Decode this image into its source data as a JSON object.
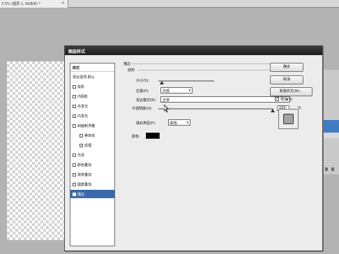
{
  "document_tab": {
    "title": "3.3% (图层 1, RGB/8) *",
    "close_glyph": "×"
  },
  "dialog": {
    "title": "图层样式",
    "styles_list": {
      "header": "样式",
      "items": [
        {
          "label": "混合选项:默认",
          "checkbox": false
        },
        {
          "label": "投影",
          "checkbox": true,
          "checked": false
        },
        {
          "label": "内阴影",
          "checkbox": true,
          "checked": false
        },
        {
          "label": "外发光",
          "checkbox": true,
          "checked": false
        },
        {
          "label": "内发光",
          "checkbox": true,
          "checked": false
        },
        {
          "label": "斜面和浮雕",
          "checkbox": true,
          "checked": false
        },
        {
          "label": "等高线",
          "checkbox": true,
          "checked": false,
          "indent": true
        },
        {
          "label": "纹理",
          "checkbox": true,
          "checked": false,
          "indent": true
        },
        {
          "label": "光泽",
          "checkbox": true,
          "checked": false
        },
        {
          "label": "颜色叠加",
          "checkbox": true,
          "checked": false
        },
        {
          "label": "渐变叠加",
          "checkbox": true,
          "checked": false
        },
        {
          "label": "图案叠加",
          "checkbox": true,
          "checked": false
        },
        {
          "label": "描边",
          "checkbox": true,
          "checked": true,
          "selected": true
        }
      ]
    },
    "stroke": {
      "section_title": "描边",
      "structure_title": "结构",
      "size_label": "大小(S):",
      "size_value": "3",
      "size_unit": "像素",
      "position_label": "位置(P):",
      "position_value": "外部",
      "blend_mode_label": "混合模式(B):",
      "blend_mode_value": "正常",
      "opacity_label": "不透明度(O):",
      "opacity_value": "100",
      "opacity_unit": "%",
      "fill_type_label": "填充类型(F):",
      "fill_type_value": "颜色",
      "color_label": "颜色:",
      "color_hex": "#000000"
    },
    "buttons": {
      "ok": "确定",
      "cancel": "取消",
      "new_style": "新建样式(W)...",
      "preview_label": "预览(V)",
      "preview_checked": true
    }
  }
}
